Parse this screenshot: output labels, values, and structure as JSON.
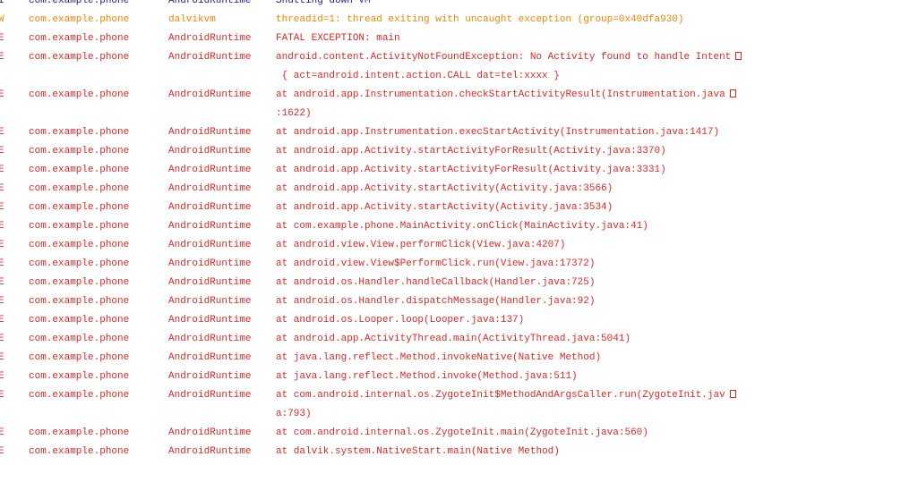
{
  "colors": {
    "info": "#1a1a8a",
    "warn": "#e8870b",
    "error": "#d42a2a"
  },
  "icons": {
    "wrap": "line-wrap-icon"
  },
  "rows": [
    {
      "level": "I",
      "pkg": "com.example.phone",
      "tag": "AndroidRuntime",
      "lines": [
        "Shutting down VM"
      ],
      "wrap": false,
      "kind": "info"
    },
    {
      "level": "W",
      "pkg": "com.example.phone",
      "tag": "dalvikvm",
      "lines": [
        "threadid=1: thread exiting with uncaught exception (group=0x40dfa930)"
      ],
      "wrap": false,
      "kind": "warn"
    },
    {
      "level": "E",
      "pkg": "com.example.phone",
      "tag": "AndroidRuntime",
      "lines": [
        "FATAL EXCEPTION: main"
      ],
      "wrap": false,
      "kind": "error"
    },
    {
      "level": "E",
      "pkg": "com.example.phone",
      "tag": "AndroidRuntime",
      "lines": [
        "android.content.ActivityNotFoundException: No Activity found to handle Intent",
        " { act=android.intent.action.CALL dat=tel:xxxx }"
      ],
      "wrap": true,
      "kind": "error"
    },
    {
      "level": "E",
      "pkg": "com.example.phone",
      "tag": "AndroidRuntime",
      "lines": [
        "at android.app.Instrumentation.checkStartActivityResult(Instrumentation.java",
        ":1622)"
      ],
      "wrap": true,
      "kind": "error"
    },
    {
      "level": "E",
      "pkg": "com.example.phone",
      "tag": "AndroidRuntime",
      "lines": [
        "at android.app.Instrumentation.execStartActivity(Instrumentation.java:1417)"
      ],
      "wrap": false,
      "kind": "error"
    },
    {
      "level": "E",
      "pkg": "com.example.phone",
      "tag": "AndroidRuntime",
      "lines": [
        "at android.app.Activity.startActivityForResult(Activity.java:3370)"
      ],
      "wrap": false,
      "kind": "error"
    },
    {
      "level": "E",
      "pkg": "com.example.phone",
      "tag": "AndroidRuntime",
      "lines": [
        "at android.app.Activity.startActivityForResult(Activity.java:3331)"
      ],
      "wrap": false,
      "kind": "error"
    },
    {
      "level": "E",
      "pkg": "com.example.phone",
      "tag": "AndroidRuntime",
      "lines": [
        "at android.app.Activity.startActivity(Activity.java:3566)"
      ],
      "wrap": false,
      "kind": "error"
    },
    {
      "level": "E",
      "pkg": "com.example.phone",
      "tag": "AndroidRuntime",
      "lines": [
        "at android.app.Activity.startActivity(Activity.java:3534)"
      ],
      "wrap": false,
      "kind": "error"
    },
    {
      "level": "E",
      "pkg": "com.example.phone",
      "tag": "AndroidRuntime",
      "lines": [
        "at com.example.phone.MainActivity.onClick(MainActivity.java:41)"
      ],
      "wrap": false,
      "kind": "error"
    },
    {
      "level": "E",
      "pkg": "com.example.phone",
      "tag": "AndroidRuntime",
      "lines": [
        "at android.view.View.performClick(View.java:4207)"
      ],
      "wrap": false,
      "kind": "error"
    },
    {
      "level": "E",
      "pkg": "com.example.phone",
      "tag": "AndroidRuntime",
      "lines": [
        "at android.view.View$PerformClick.run(View.java:17372)"
      ],
      "wrap": false,
      "kind": "error"
    },
    {
      "level": "E",
      "pkg": "com.example.phone",
      "tag": "AndroidRuntime",
      "lines": [
        "at android.os.Handler.handleCallback(Handler.java:725)"
      ],
      "wrap": false,
      "kind": "error"
    },
    {
      "level": "E",
      "pkg": "com.example.phone",
      "tag": "AndroidRuntime",
      "lines": [
        "at android.os.Handler.dispatchMessage(Handler.java:92)"
      ],
      "wrap": false,
      "kind": "error"
    },
    {
      "level": "E",
      "pkg": "com.example.phone",
      "tag": "AndroidRuntime",
      "lines": [
        "at android.os.Looper.loop(Looper.java:137)"
      ],
      "wrap": false,
      "kind": "error"
    },
    {
      "level": "E",
      "pkg": "com.example.phone",
      "tag": "AndroidRuntime",
      "lines": [
        "at android.app.ActivityThread.main(ActivityThread.java:5041)"
      ],
      "wrap": false,
      "kind": "error"
    },
    {
      "level": "E",
      "pkg": "com.example.phone",
      "tag": "AndroidRuntime",
      "lines": [
        "at java.lang.reflect.Method.invokeNative(Native Method)"
      ],
      "wrap": false,
      "kind": "error"
    },
    {
      "level": "E",
      "pkg": "com.example.phone",
      "tag": "AndroidRuntime",
      "lines": [
        "at java.lang.reflect.Method.invoke(Method.java:511)"
      ],
      "wrap": false,
      "kind": "error"
    },
    {
      "level": "E",
      "pkg": "com.example.phone",
      "tag": "AndroidRuntime",
      "lines": [
        "at com.android.internal.os.ZygoteInit$MethodAndArgsCaller.run(ZygoteInit.jav",
        "a:793)"
      ],
      "wrap": true,
      "kind": "error"
    },
    {
      "level": "E",
      "pkg": "com.example.phone",
      "tag": "AndroidRuntime",
      "lines": [
        "at com.android.internal.os.ZygoteInit.main(ZygoteInit.java:560)"
      ],
      "wrap": false,
      "kind": "error"
    },
    {
      "level": "E",
      "pkg": "com.example.phone",
      "tag": "AndroidRuntime",
      "lines": [
        "at dalvik.system.NativeStart.main(Native Method)"
      ],
      "wrap": false,
      "kind": "error"
    }
  ]
}
